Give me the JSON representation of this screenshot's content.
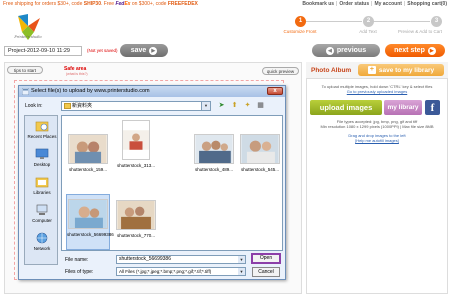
{
  "topbar": {
    "promo_a": "Free shipping for orders $30+, code ",
    "promo_code1": "SHIP30",
    "promo_b": ". Free ",
    "fedex_fe": "Fed",
    "fedex_ex": "Ex",
    "promo_c": " on $300+, code ",
    "promo_code2": "FREEFEDEX",
    "links": [
      "Bookmark us",
      "Order status",
      "My account",
      "Shopping cart(0)"
    ]
  },
  "logo": {
    "text": "Printer's studio"
  },
  "steps": [
    {
      "number": "1",
      "label": "Customize Front",
      "active": true
    },
    {
      "number": "2",
      "label": "Add Text",
      "active": false
    },
    {
      "number": "3",
      "label": "Preview & Add to Cart",
      "active": false
    }
  ],
  "project": {
    "name": "Project-2012-09-10 11:29",
    "status": "(Not yet saved)",
    "save_label": "save"
  },
  "nav": {
    "previous_label": "previous",
    "next_label": "next step"
  },
  "canvas": {
    "tips_label": "tips to start",
    "safe_area": "Safe area",
    "safe_sub": "(what is this?)",
    "quick_preview_label": "quick preview"
  },
  "dialog": {
    "title": "Select file(s) to upload by www.printerstudio.com",
    "close_label": "x",
    "look_in_label": "Look in:",
    "look_in_value": "新資料夾",
    "places": [
      "Recent Places",
      "Desktop",
      "Libraries",
      "Computer",
      "Network"
    ],
    "files": [
      {
        "name": "shutterstock_159...",
        "selected": false
      },
      {
        "name": "shutterstock_313...",
        "selected": false
      },
      {
        "name": "shutterstock_489...",
        "selected": false
      },
      {
        "name": "shutterstock_545...",
        "selected": false
      },
      {
        "name": "shutterstock_56699386",
        "selected": true
      },
      {
        "name": "shutterstock_770...",
        "selected": false
      }
    ],
    "file_name_label": "File name:",
    "file_name_value": "shutterstock_56699386",
    "file_type_label": "Files of type:",
    "file_type_value": "All Files (*.jpg;*.jpeg;*.bmp;*.png;*.gif;*.tif;*.tiff)",
    "open_label": "Open",
    "cancel_label": "Cancel"
  },
  "album": {
    "title": "Photo Album",
    "save_library_label": "save to my library",
    "upload_info_1": "To upload multiple images, hold down 'CTRL' key & select files",
    "upload_info_2": "Go to previously uploaded images",
    "upload_label": "upload images",
    "my_library_label": "my library",
    "facebook_label": "f",
    "req_1": "File types accepted: jpg, bmp, png, gif and tiff",
    "req_2": "Min resolution 1080 x 1299 pixels (1000PPI) | Max file size 8MB",
    "drag_1": "Drag and drop images to the left",
    "drag_2": "[Help me autofill images]"
  },
  "colors": {
    "accent_orange": "#f26a10",
    "upload_green": "#9ab82a",
    "library_purple": "#c386c0",
    "facebook_blue": "#3b5998",
    "open_highlight": "#8c3fa8"
  }
}
